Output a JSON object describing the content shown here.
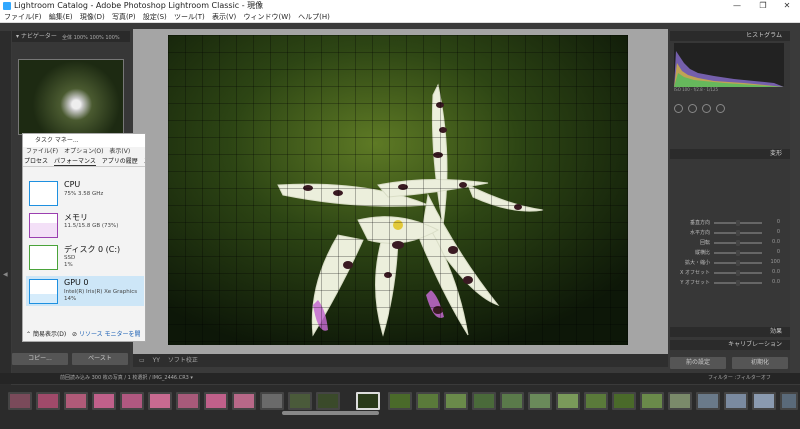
{
  "window": {
    "title": "Lightroom Catalog - Adobe Photoshop Lightroom Classic - 現像"
  },
  "menu": [
    "ファイル(F)",
    "編集(E)",
    "現像(D)",
    "写真(P)",
    "設定(S)",
    "ツール(T)",
    "表示(V)",
    "ウィンドウ(W)",
    "ヘルプ(H)"
  ],
  "left_panel": {
    "navigator": "ナビゲーター",
    "zoom": "全体  100%  100%  100%"
  },
  "right_panel": {
    "histogram": "ヒストグラム",
    "transform": "変形",
    "effects": "効果",
    "calibration": "キャリブレーション"
  },
  "sliders": [
    {
      "label": "垂直方向",
      "value": "0"
    },
    {
      "label": "水平方向",
      "value": "0"
    },
    {
      "label": "回転",
      "value": "0.0"
    },
    {
      "label": "縦横比",
      "value": "0"
    },
    {
      "label": "拡大・縮小",
      "value": "100"
    },
    {
      "label": "X オフセット",
      "value": "0.0"
    },
    {
      "label": "Y オフセット",
      "value": "0.0"
    }
  ],
  "buttons": {
    "previous": "前の設定",
    "reset": "初期化",
    "left_copy": "コピー...",
    "left_paste": "ペースト"
  },
  "toolbar": {
    "softproof": "ソフト校正"
  },
  "filmstrip": {
    "info": "前回読み込み  300 枚の写真 / 1 枚選択 / IMG_2446.CR3 ▾",
    "filter": "フィルター :",
    "filter_value": "フィルターオフ"
  },
  "task_manager": {
    "title": "タスク マネー...",
    "menu": [
      "ファイル(F)",
      "オプション(O)",
      "表示(V)"
    ],
    "tabs": [
      "プロセス",
      "パフォーマンス",
      "アプリの履歴",
      "スタ"
    ],
    "rows": [
      {
        "name": "CPU",
        "line1": "75%  3.58 GHz",
        "line2": "",
        "color": "#1e90e0"
      },
      {
        "name": "メモリ",
        "line1": "11.5/15.8 GB (73%)",
        "line2": "",
        "color": "#9b3fb0"
      },
      {
        "name": "ディスク 0 (C:)",
        "line1": "SSD",
        "line2": "1%",
        "color": "#4aa33a"
      },
      {
        "name": "GPU 0",
        "line1": "Intel(R) Iris(R) Xe Graphics",
        "line2": "14%",
        "color": "#1e90e0"
      }
    ],
    "footer_less": "簡易表示(D)",
    "footer_monitor": "リソース モニターを開"
  }
}
